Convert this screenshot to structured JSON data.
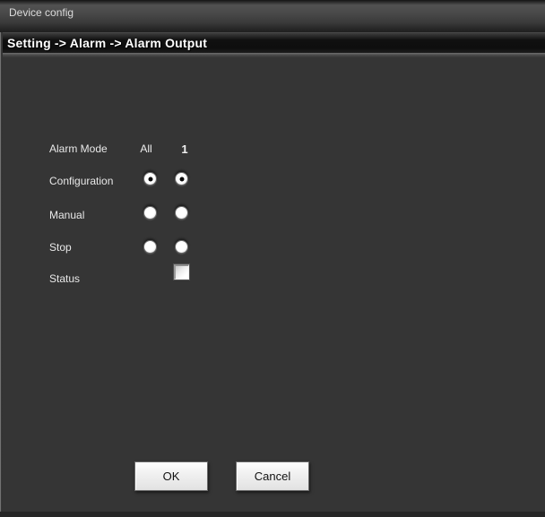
{
  "window": {
    "title": "Device config"
  },
  "breadcrumb": "Setting -> Alarm -> Alarm Output",
  "form": {
    "mode_label": "Alarm Mode",
    "col_all": "All",
    "col_one": "1",
    "rows": {
      "configuration": {
        "label": "Configuration",
        "all_checked": true,
        "one_checked": true
      },
      "manual": {
        "label": "Manual",
        "all_checked": false,
        "one_checked": false
      },
      "stop": {
        "label": "Stop",
        "all_checked": false,
        "one_checked": false
      },
      "status": {
        "label": "Status",
        "one_checked": false
      }
    }
  },
  "buttons": {
    "ok": "OK",
    "cancel": "Cancel"
  },
  "colors": {
    "content_bg": "#353535",
    "titlebar_bg": "#474747",
    "breadcrumb_bg": "#101010",
    "breadcrumb_text": "#ffffff",
    "label_text": "#e8e8e8",
    "button_bg": "#efefef",
    "radio_dot": "#0a0a0a"
  }
}
